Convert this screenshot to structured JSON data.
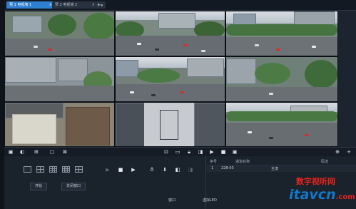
{
  "tabs": [
    {
      "label": "预 1 电视墙 1",
      "close": "×"
    },
    {
      "label": "预 2 电视墙 2",
      "close": "×"
    }
  ],
  "add_tab": {
    "label": "+",
    "dropdown": "▾"
  },
  "toolbar": {
    "left_icons": [
      "save-icon",
      "lock-icon",
      "layout-grid-icon",
      "fullscreen-icon",
      "close-square-icon"
    ],
    "center_icons": [
      "fit-icon",
      "screen-icon",
      "lock-icon",
      "unlock-icon",
      "play-icon",
      "stop-icon",
      "record-icon"
    ],
    "right_icons": [
      "crosshair-icon",
      "add-icon"
    ]
  },
  "controls": {
    "open_label": "开始",
    "close_window_label": "关闭窗口",
    "icons": [
      "prev-icon",
      "stop-icon",
      "play-icon",
      "light-icon",
      "download-icon",
      "unlock-icon",
      "lock-icon"
    ]
  },
  "list": {
    "headers": {
      "seq": "序号",
      "channel": "通道名称",
      "status": "码流"
    },
    "rows": [
      {
        "seq": "1",
        "channel": "228-03",
        "status": "主流"
      }
    ]
  },
  "bottom_tabs": [
    "窗口",
    "虚拟LED"
  ],
  "watermark": {
    "cn": "数字视听网",
    "en": "itavcn",
    "suffix": ".com"
  }
}
